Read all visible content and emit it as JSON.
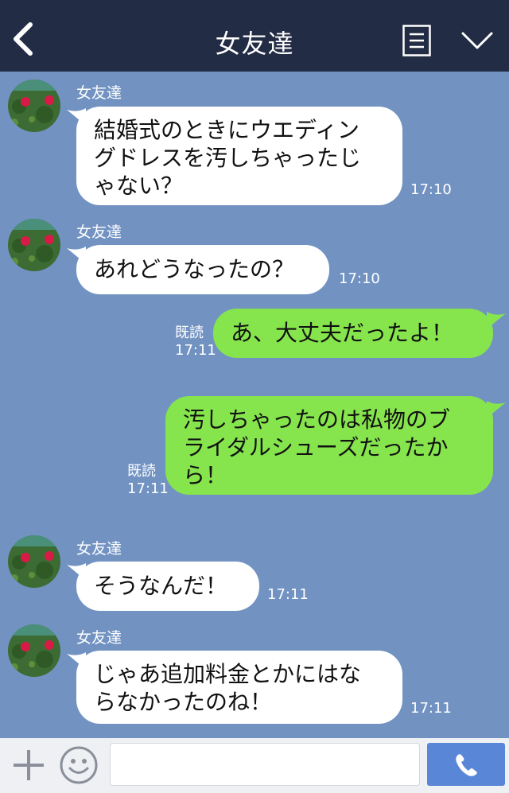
{
  "header": {
    "title": "女友達"
  },
  "messages": [
    {
      "sender": "女友達",
      "text_lines": [
        "結婚式のときにウエディン",
        "グドレスを汚しちゃったじ",
        "ゃない？"
      ],
      "time": "17:10"
    },
    {
      "sender": "女友達",
      "text_lines": [
        "あれどうなったの？"
      ],
      "time": "17:10"
    },
    {
      "read": "既読",
      "text_lines": [
        "あ、大丈夫だったよ！"
      ],
      "time": "17:11"
    },
    {
      "read": "既読",
      "text_lines": [
        "汚しちゃったのは私物のブ",
        "ライダルシューズだったか",
        "ら！"
      ],
      "time": "17:11"
    },
    {
      "sender": "女友達",
      "text_lines": [
        "そうなんだ！"
      ],
      "time": "17:11"
    },
    {
      "sender": "女友達",
      "text_lines": [
        "じゃあ追加料金とかにはな",
        "らなかったのね！"
      ],
      "time": "17:11"
    }
  ],
  "input": {
    "value": "",
    "placeholder": ""
  },
  "icons": {
    "back": "chevron-left-icon",
    "menu": "document-menu-icon",
    "collapse": "chevron-down-icon",
    "plus": "plus-icon",
    "emoji": "smiley-icon",
    "call": "phone-icon"
  },
  "colors": {
    "header_bg": "#232c45",
    "chat_bg": "#7293c2",
    "incoming_bubble": "#ffffff",
    "outgoing_bubble": "#86e44d",
    "call_button": "#5a86d8"
  }
}
